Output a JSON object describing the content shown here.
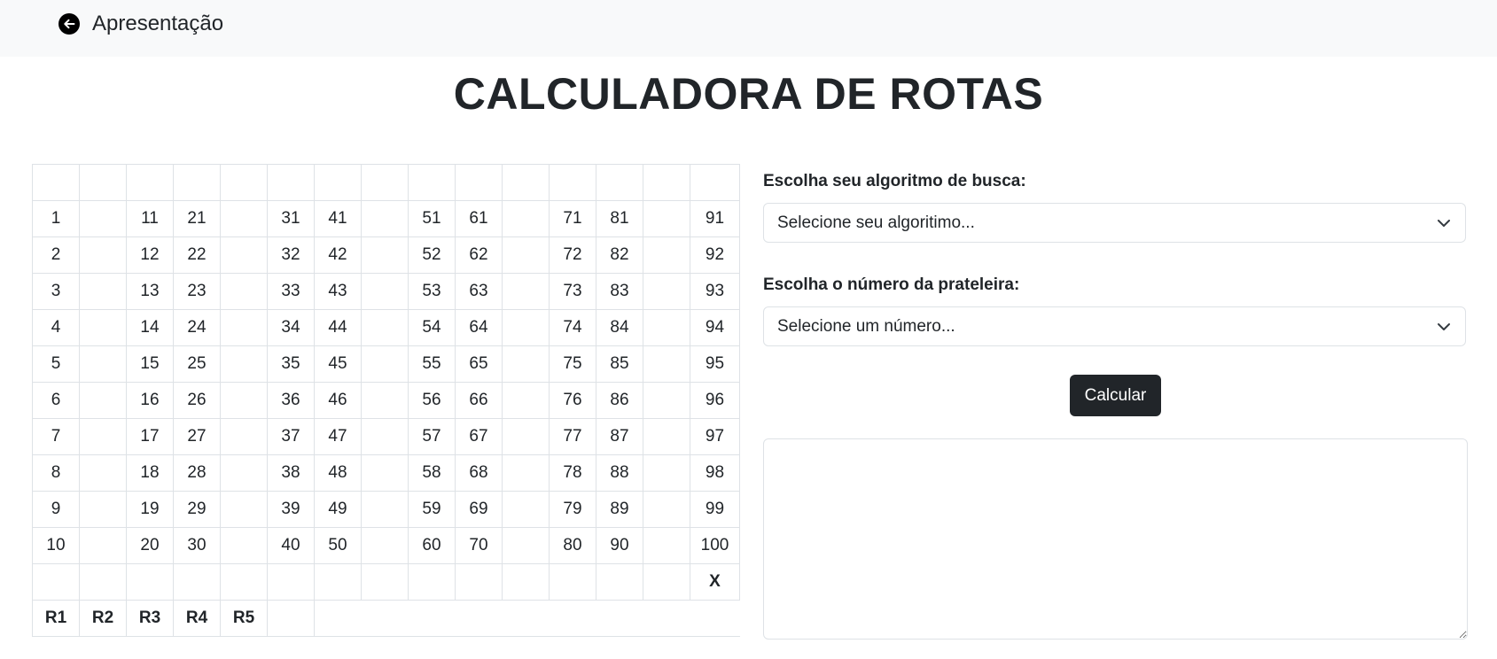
{
  "header": {
    "back_label": "Apresentação",
    "back_icon": "arrow-left-circle-icon"
  },
  "title": "CALCULADORA DE ROTAS",
  "grid": {
    "rows": [
      [
        "",
        "",
        "",
        "",
        "",
        "",
        "",
        "",
        "",
        "",
        "",
        "",
        "",
        "",
        "",
        ""
      ],
      [
        "1",
        "",
        "11",
        "21",
        "",
        "31",
        "41",
        "",
        "51",
        "61",
        "",
        "71",
        "81",
        "",
        "91"
      ],
      [
        "2",
        "",
        "12",
        "22",
        "",
        "32",
        "42",
        "",
        "52",
        "62",
        "",
        "72",
        "82",
        "",
        "92"
      ],
      [
        "3",
        "",
        "13",
        "23",
        "",
        "33",
        "43",
        "",
        "53",
        "63",
        "",
        "73",
        "83",
        "",
        "93"
      ],
      [
        "4",
        "",
        "14",
        "24",
        "",
        "34",
        "44",
        "",
        "54",
        "64",
        "",
        "74",
        "84",
        "",
        "94"
      ],
      [
        "5",
        "",
        "15",
        "25",
        "",
        "35",
        "45",
        "",
        "55",
        "65",
        "",
        "75",
        "85",
        "",
        "95"
      ],
      [
        "6",
        "",
        "16",
        "26",
        "",
        "36",
        "46",
        "",
        "56",
        "66",
        "",
        "76",
        "86",
        "",
        "96"
      ],
      [
        "7",
        "",
        "17",
        "27",
        "",
        "37",
        "47",
        "",
        "57",
        "67",
        "",
        "77",
        "87",
        "",
        "97"
      ],
      [
        "8",
        "",
        "18",
        "28",
        "",
        "38",
        "48",
        "",
        "58",
        "68",
        "",
        "78",
        "88",
        "",
        "98"
      ],
      [
        "9",
        "",
        "19",
        "29",
        "",
        "39",
        "49",
        "",
        "59",
        "69",
        "",
        "79",
        "89",
        "",
        "99"
      ],
      [
        "10",
        "",
        "20",
        "30",
        "",
        "40",
        "50",
        "",
        "60",
        "70",
        "",
        "80",
        "90",
        "",
        "100"
      ],
      [
        "",
        "",
        "",
        "",
        "",
        "",
        "",
        "",
        "",
        "",
        "",
        "",
        "",
        "",
        "X"
      ]
    ],
    "routes": [
      "R1",
      "R2",
      "R3",
      "R4",
      "R5"
    ]
  },
  "form": {
    "algorithm_label": "Escolha seu algoritmo de busca:",
    "algorithm_placeholder": "Selecione seu algoritimo...",
    "shelf_label": "Escolha o número da prateleira:",
    "shelf_placeholder": "Selecione um número...",
    "calculate_label": "Calcular",
    "result_value": ""
  },
  "colors": {
    "topbar_bg": "#f8f9fa",
    "button_bg": "#212529",
    "border": "#dee2e6"
  }
}
